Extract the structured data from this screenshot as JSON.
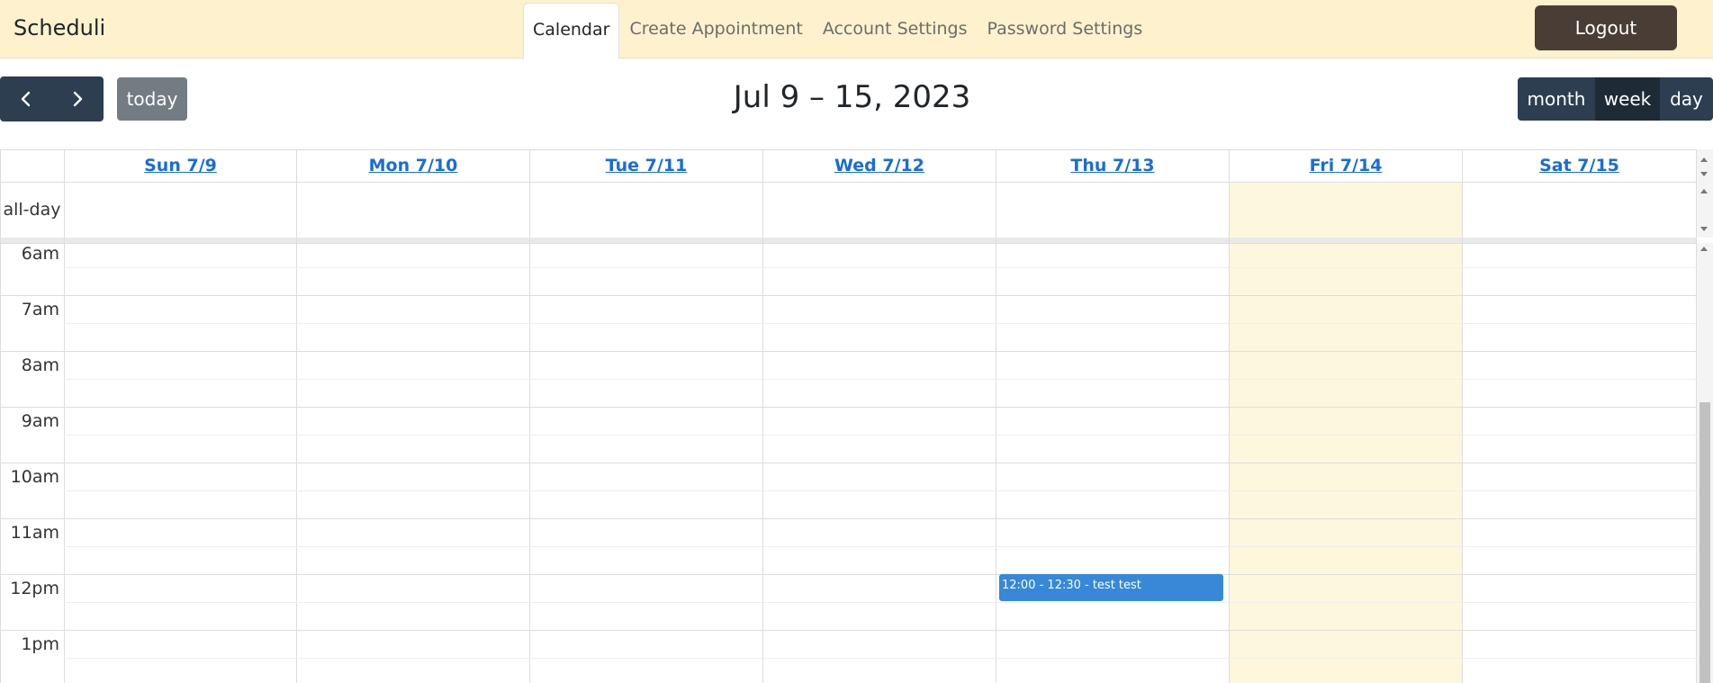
{
  "navbar": {
    "brand": "Scheduli",
    "tabs": [
      {
        "label": "Calendar",
        "active": true
      },
      {
        "label": "Create Appointment",
        "active": false
      },
      {
        "label": "Account Settings",
        "active": false
      },
      {
        "label": "Password Settings",
        "active": false
      }
    ],
    "logout_label": "Logout"
  },
  "toolbar": {
    "prev_icon": "chevron-left-icon",
    "next_icon": "chevron-right-icon",
    "today_label": "today",
    "title": "Jul 9 – 15, 2023",
    "views": [
      {
        "label": "month",
        "active": false
      },
      {
        "label": "week",
        "active": true
      },
      {
        "label": "day",
        "active": false
      }
    ]
  },
  "calendar": {
    "days": [
      "Sun 7/9",
      "Mon 7/10",
      "Tue 7/11",
      "Wed 7/12",
      "Thu 7/13",
      "Fri 7/14",
      "Sat 7/15"
    ],
    "today_day": "Fri 7/14",
    "allday_label": "all-day",
    "time_labels": [
      "6am",
      "7am",
      "8am",
      "9am",
      "10am",
      "11am",
      "12pm",
      "1pm"
    ],
    "events": [
      {
        "day": "Thu 7/13",
        "start": "12:00",
        "end": "12:30",
        "text": "12:00 - 12:30 - test test"
      }
    ]
  },
  "colors": {
    "navbar_bg": "#fdf2cd",
    "primary_dark": "#2c3e50",
    "logout_bg": "#4a3d36",
    "event_bg": "#3788d8",
    "today_highlight": "#fdf7dd",
    "link": "#1a6cd9"
  }
}
